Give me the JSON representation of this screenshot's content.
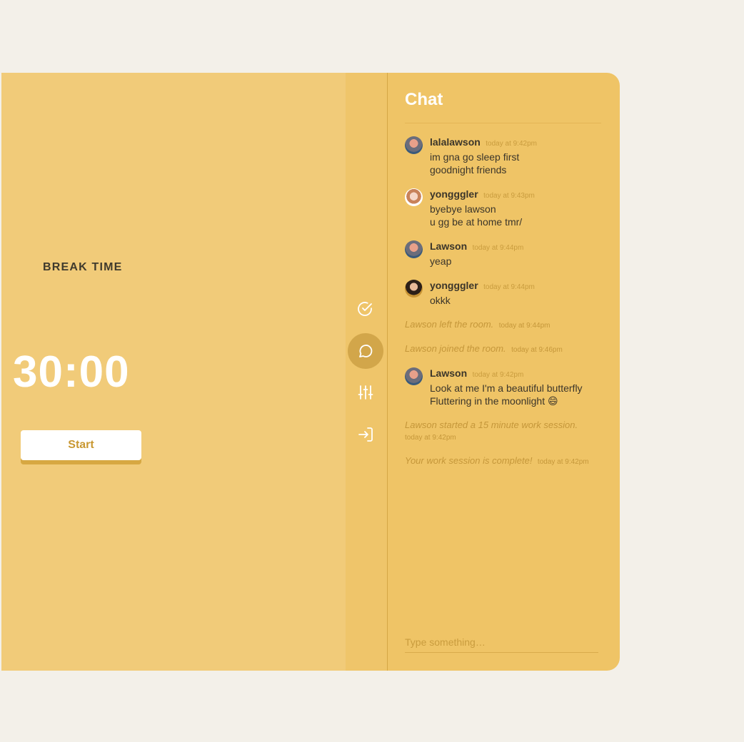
{
  "timer": {
    "mode_label": "BREAK TIME",
    "time": "30:00",
    "start_label": "Start"
  },
  "rail": {
    "items": [
      {
        "name": "tasks",
        "icon": "check-circle-icon",
        "active": false
      },
      {
        "name": "chat",
        "icon": "chat-bubble-icon",
        "active": true
      },
      {
        "name": "settings",
        "icon": "sliders-icon",
        "active": false
      },
      {
        "name": "leave",
        "icon": "enter-room-icon",
        "active": false
      }
    ]
  },
  "chat": {
    "title": "Chat",
    "messages": [
      {
        "user": "lalalawson",
        "time": "today at 9:42pm",
        "lines": [
          "im gna go sleep first",
          "goodnight friends"
        ]
      },
      {
        "user": "yongggler",
        "time": "today at 9:43pm",
        "lines": [
          "byebye lawson",
          "u gg be at home tmr/"
        ]
      },
      {
        "user": "Lawson",
        "time": "today at 9:44pm",
        "lines": [
          "yeap"
        ]
      },
      {
        "user": "yongggler",
        "time": "today at 9:44pm",
        "lines": [
          "okkk"
        ]
      },
      {
        "user": "Lawson",
        "time": "today at 9:42pm",
        "lines": [
          "Look at me I'm a beautiful butterfly",
          "Fluttering in the moonlight 😄"
        ]
      }
    ],
    "system": [
      {
        "text": "Lawson left the room.",
        "time": "today at 9:44pm"
      },
      {
        "text": "Lawson joined the room.",
        "time": "today at 9:46pm"
      },
      {
        "text": "Lawson started a 15 minute work session.",
        "time": "today at 9:42pm"
      },
      {
        "text": "Your work session is complete!",
        "time": "today at 9:42pm"
      }
    ],
    "input_placeholder": "Type something…"
  },
  "colors": {
    "page_bg": "#f3f0e9",
    "timer_bg": "#f1cb79",
    "chat_bg": "#efc466",
    "accent": "#c99832",
    "text_dark": "#3b352a"
  }
}
